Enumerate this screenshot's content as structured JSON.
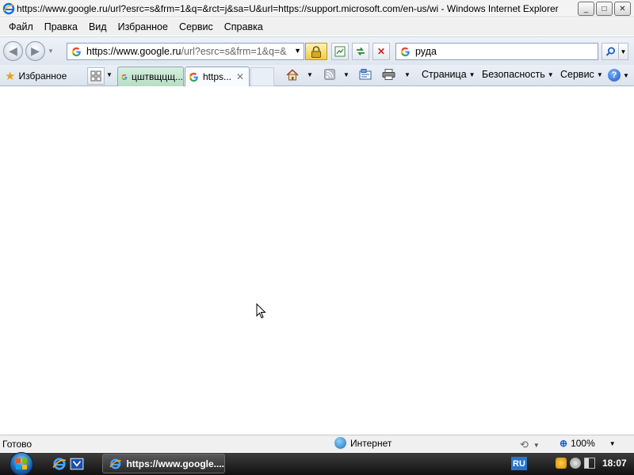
{
  "window": {
    "title": "https://www.google.ru/url?esrc=s&frm=1&q=&rct=j&sa=U&url=https://support.microsoft.com/en-us/wi - Windows Internet Explorer",
    "buttons": {
      "minimize": "_",
      "maximize": "□",
      "close": "✕"
    }
  },
  "menubar": {
    "items": [
      "Файл",
      "Правка",
      "Вид",
      "Избранное",
      "Сервис",
      "Справка"
    ]
  },
  "address_bar": {
    "url_prefix": "https://www.google.ru",
    "url_rest": "/url?esrc=s&frm=1&q=&"
  },
  "search": {
    "query": "руда"
  },
  "favorites": {
    "label": "Избранное"
  },
  "tabs": [
    {
      "title": "цштвщцщ...",
      "active": false
    },
    {
      "title": "https...",
      "active": true
    }
  ],
  "command_bar": {
    "page": "Страница",
    "safety": "Безопасность",
    "tools": "Сервис"
  },
  "status_bar": {
    "text": "Готово",
    "zone": "Интернет",
    "zoom": "100%"
  },
  "taskbar": {
    "task_title": "https://www.google....",
    "language": "RU",
    "clock": "18:07"
  },
  "colors": {
    "taskbar": "#1f1f1f",
    "inactive_tab": "#b5dfc2",
    "lock": "#f2c94c"
  }
}
